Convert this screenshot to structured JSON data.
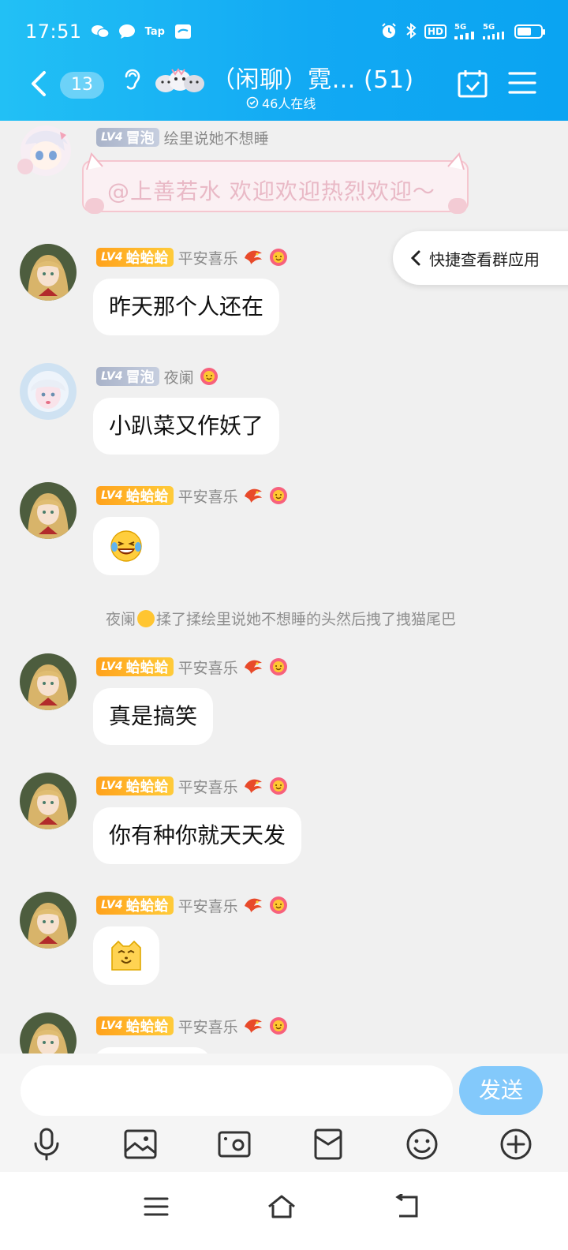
{
  "status_bar": {
    "time": "17:51",
    "icons": [
      "wechat-icon",
      "message-icon",
      "taptap-icon",
      "app-icon"
    ],
    "right_icons": [
      "alarm-icon",
      "bluetooth-icon",
      "hd-icon",
      "signal-5g-icon",
      "signal-5g-icon",
      "battery-icon"
    ],
    "hd": "HD",
    "net1": "5G",
    "net2": "5G",
    "battery_level": 0.6
  },
  "header": {
    "unread_count": "13",
    "title": "（闲聊）霓… (51)",
    "online": "46人在线",
    "accent": "#12a9f3"
  },
  "messages": [
    {
      "badge_level": "LV4",
      "badge_title": "冒泡",
      "nick": "绘里说她不想睡",
      "welcome": "@上善若水 欢迎欢迎热烈欢迎～"
    },
    {
      "badge_level": "LV4",
      "badge_title": "蛤蛤蛤",
      "nick": "平安喜乐",
      "text": "昨天那个人还在"
    },
    {
      "badge_level": "LV4",
      "badge_title": "冒泡",
      "nick": "夜阑",
      "text": "小趴菜又作妖了"
    },
    {
      "badge_level": "LV4",
      "badge_title": "蛤蛤蛤",
      "nick": "平安喜乐",
      "emoji": "😂"
    },
    {
      "badge_level": "LV4",
      "badge_title": "蛤蛤蛤",
      "nick": "平安喜乐",
      "text": "真是搞笑"
    },
    {
      "badge_level": "LV4",
      "badge_title": "蛤蛤蛤",
      "nick": "平安喜乐",
      "text": "你有种你就天天发"
    },
    {
      "badge_level": "LV4",
      "badge_title": "蛤蛤蛤",
      "nick": "平安喜乐",
      "emoji": "cat-face"
    },
    {
      "badge_level": "LV4",
      "badge_title": "蛤蛤蛤",
      "nick": "平安喜乐"
    }
  ],
  "system_message": {
    "actor": "夜阑",
    "text": "揉了揉绘里说她不想睡的头然后拽了拽猫尾巴"
  },
  "quick_panel": {
    "label": "快捷查看群应用"
  },
  "input": {
    "placeholder": "",
    "send_label": "发送"
  },
  "toolbar_icons": [
    "microphone-icon",
    "image-icon",
    "camera-icon",
    "red-packet-icon",
    "emoji-icon",
    "plus-icon"
  ],
  "nav_icons": [
    "menu-icon",
    "home-icon",
    "back-icon"
  ]
}
